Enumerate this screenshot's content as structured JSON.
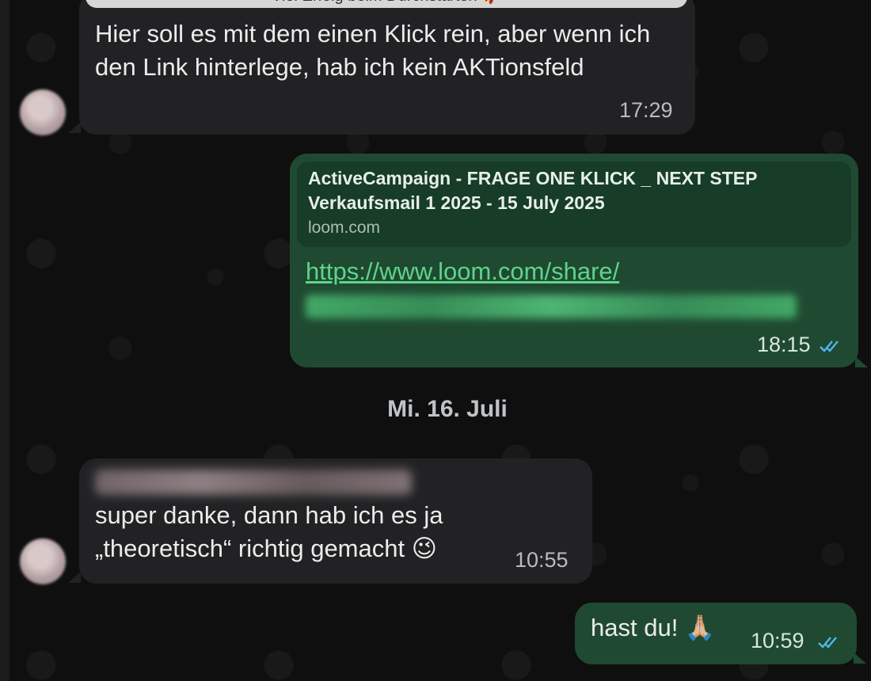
{
  "messages": {
    "m1": {
      "preview_caption": "Viel Erfolg beim Durchstarten 🚀",
      "text": "Hier soll es mit dem einen Klick rein, aber wenn ich den Link hinterlege, hab ich kein AKTionsfeld",
      "time": "17:29"
    },
    "m2": {
      "link_title": "ActiveCampaign - FRAGE ONE KLICK _ NEXT STEP Verkaufsmail 1 2025 - 15 July 2025",
      "link_domain": "loom.com",
      "url": "https://www.loom.com/share/",
      "time": "18:15"
    },
    "m3": {
      "text": "super danke, dann hab ich es ja „theoretisch“ richtig gemacht 😉",
      "time": "10:55"
    },
    "m4": {
      "text": "hast du! 🙏🏼",
      "time": "10:59"
    }
  },
  "date_separator": "Mi. 16. Juli",
  "colors": {
    "incoming_bubble": "#222224",
    "outgoing_bubble": "#1f4a31",
    "read_check": "#4fb6ec",
    "link": "#5fd48a"
  }
}
